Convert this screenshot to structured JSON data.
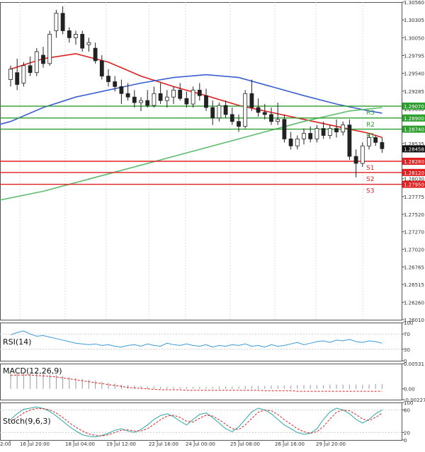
{
  "chart_data": [
    {
      "type": "candlestick",
      "panel": "price",
      "title": "",
      "ylim": [
        1.2601,
        1.3056
      ],
      "y_ticks": [
        "1.30560",
        "1.30305",
        "1.30050",
        "1.29795",
        "1.29540",
        "1.29285",
        "1.29030",
        "1.28535",
        "1.28030",
        "1.27775",
        "1.27520",
        "1.27270",
        "1.27020",
        "1.26765",
        "1.26515",
        "1.26260",
        "1.26010"
      ],
      "x_ticks": [
        "2:00",
        "16 Jul 20:00",
        "18 Jul 04:00",
        "19 Jul 12:00",
        "22 Jul 16:00",
        "24 Jul 00:00",
        "25 Jul 08:00",
        "26 Jul 16:00",
        "29 Jul 20:00"
      ],
      "current_price": {
        "label": "1.28458",
        "value": 1.28458
      },
      "levels": [
        {
          "name": "R3",
          "label": "1.29070",
          "value": 1.2907,
          "color": "#2e9e2e"
        },
        {
          "name": "R2",
          "label": "1.28900",
          "value": 1.289,
          "color": "#2e9e2e"
        },
        {
          "name": "R1",
          "label": "1.28740",
          "value": 1.2874,
          "color": "#2e9e2e"
        },
        {
          "name": "S1",
          "label": "1.28280",
          "value": 1.2828,
          "color": "#e02020"
        },
        {
          "name": "S2",
          "label": "1.28120",
          "value": 1.2812,
          "color": "#e02020"
        },
        {
          "name": "S3",
          "label": "1.27950",
          "value": 1.2795,
          "color": "#e02020"
        }
      ],
      "candles": [
        {
          "o": 1.2945,
          "h": 1.2965,
          "l": 1.2935,
          "c": 1.296
        },
        {
          "o": 1.2955,
          "h": 1.2975,
          "l": 1.293,
          "c": 1.2938
        },
        {
          "o": 1.294,
          "h": 1.297,
          "l": 1.2935,
          "c": 1.2965
        },
        {
          "o": 1.2965,
          "h": 1.2978,
          "l": 1.295,
          "c": 1.2955
        },
        {
          "o": 1.2955,
          "h": 1.299,
          "l": 1.295,
          "c": 1.2985
        },
        {
          "o": 1.298,
          "h": 1.2992,
          "l": 1.2962,
          "c": 1.2968
        },
        {
          "o": 1.2968,
          "h": 1.3015,
          "l": 1.2965,
          "c": 1.301
        },
        {
          "o": 1.3015,
          "h": 1.3045,
          "l": 1.3005,
          "c": 1.304
        },
        {
          "o": 1.304,
          "h": 1.305,
          "l": 1.301,
          "c": 1.3015
        },
        {
          "o": 1.3015,
          "h": 1.302,
          "l": 1.2998,
          "c": 1.3005
        },
        {
          "o": 1.3005,
          "h": 1.3015,
          "l": 1.2995,
          "c": 1.301
        },
        {
          "o": 1.301,
          "h": 1.3015,
          "l": 1.2985,
          "c": 1.299
        },
        {
          "o": 1.2995,
          "h": 1.3005,
          "l": 1.2985,
          "c": 1.2998
        },
        {
          "o": 1.299,
          "h": 1.2998,
          "l": 1.2968,
          "c": 1.2972
        },
        {
          "o": 1.2972,
          "h": 1.298,
          "l": 1.2945,
          "c": 1.295
        },
        {
          "o": 1.295,
          "h": 1.296,
          "l": 1.2935,
          "c": 1.2942
        },
        {
          "o": 1.2942,
          "h": 1.295,
          "l": 1.2928,
          "c": 1.2935
        },
        {
          "o": 1.2935,
          "h": 1.2945,
          "l": 1.291,
          "c": 1.2925
        },
        {
          "o": 1.2925,
          "h": 1.294,
          "l": 1.2915,
          "c": 1.292
        },
        {
          "o": 1.292,
          "h": 1.293,
          "l": 1.2905,
          "c": 1.2912
        },
        {
          "o": 1.2912,
          "h": 1.292,
          "l": 1.29,
          "c": 1.2915
        },
        {
          "o": 1.2915,
          "h": 1.293,
          "l": 1.2905,
          "c": 1.2908
        },
        {
          "o": 1.2908,
          "h": 1.2935,
          "l": 1.2905,
          "c": 1.2925
        },
        {
          "o": 1.2925,
          "h": 1.294,
          "l": 1.291,
          "c": 1.2915
        },
        {
          "o": 1.2915,
          "h": 1.293,
          "l": 1.2905,
          "c": 1.292
        },
        {
          "o": 1.292,
          "h": 1.2935,
          "l": 1.291,
          "c": 1.293
        },
        {
          "o": 1.293,
          "h": 1.294,
          "l": 1.2915,
          "c": 1.2918
        },
        {
          "o": 1.2918,
          "h": 1.2928,
          "l": 1.2905,
          "c": 1.291
        },
        {
          "o": 1.291,
          "h": 1.2935,
          "l": 1.2905,
          "c": 1.293
        },
        {
          "o": 1.293,
          "h": 1.294,
          "l": 1.2915,
          "c": 1.2922
        },
        {
          "o": 1.2922,
          "h": 1.2932,
          "l": 1.29,
          "c": 1.2905
        },
        {
          "o": 1.2905,
          "h": 1.2915,
          "l": 1.288,
          "c": 1.289
        },
        {
          "o": 1.289,
          "h": 1.2912,
          "l": 1.2885,
          "c": 1.2908
        },
        {
          "o": 1.2908,
          "h": 1.2915,
          "l": 1.289,
          "c": 1.2895
        },
        {
          "o": 1.2895,
          "h": 1.2905,
          "l": 1.288,
          "c": 1.2885
        },
        {
          "o": 1.2885,
          "h": 1.2895,
          "l": 1.287,
          "c": 1.2878
        },
        {
          "o": 1.2878,
          "h": 1.293,
          "l": 1.2875,
          "c": 1.2925
        },
        {
          "o": 1.2925,
          "h": 1.2945,
          "l": 1.29,
          "c": 1.2905
        },
        {
          "o": 1.2905,
          "h": 1.2918,
          "l": 1.2892,
          "c": 1.2898
        },
        {
          "o": 1.2898,
          "h": 1.291,
          "l": 1.2888,
          "c": 1.2895
        },
        {
          "o": 1.2895,
          "h": 1.2905,
          "l": 1.288,
          "c": 1.2885
        },
        {
          "o": 1.2885,
          "h": 1.2912,
          "l": 1.288,
          "c": 1.2888
        },
        {
          "o": 1.2888,
          "h": 1.2895,
          "l": 1.2855,
          "c": 1.286
        },
        {
          "o": 1.286,
          "h": 1.287,
          "l": 1.2845,
          "c": 1.285
        },
        {
          "o": 1.285,
          "h": 1.2865,
          "l": 1.2845,
          "c": 1.286
        },
        {
          "o": 1.286,
          "h": 1.2875,
          "l": 1.2852,
          "c": 1.2868
        },
        {
          "o": 1.2868,
          "h": 1.2878,
          "l": 1.2855,
          "c": 1.286
        },
        {
          "o": 1.286,
          "h": 1.288,
          "l": 1.2855,
          "c": 1.2875
        },
        {
          "o": 1.2875,
          "h": 1.2885,
          "l": 1.286,
          "c": 1.2865
        },
        {
          "o": 1.2865,
          "h": 1.288,
          "l": 1.286,
          "c": 1.2875
        },
        {
          "o": 1.2875,
          "h": 1.2888,
          "l": 1.2862,
          "c": 1.287
        },
        {
          "o": 1.287,
          "h": 1.2885,
          "l": 1.2865,
          "c": 1.288
        },
        {
          "o": 1.288,
          "h": 1.2888,
          "l": 1.283,
          "c": 1.2835
        },
        {
          "o": 1.2835,
          "h": 1.2845,
          "l": 1.2805,
          "c": 1.2825
        },
        {
          "o": 1.2825,
          "h": 1.2855,
          "l": 1.282,
          "c": 1.285
        },
        {
          "o": 1.285,
          "h": 1.2868,
          "l": 1.2845,
          "c": 1.2862
        },
        {
          "o": 1.2862,
          "h": 1.2865,
          "l": 1.285,
          "c": 1.2855
        },
        {
          "o": 1.2855,
          "h": 1.2862,
          "l": 1.284,
          "c": 1.2846
        }
      ],
      "moving_averages": [
        {
          "color": "#e02020",
          "values": [
            {
              "x": 0,
              "y": 1.296
            },
            {
              "x": 5,
              "y": 1.2975
            },
            {
              "x": 10,
              "y": 1.2982
            },
            {
              "x": 15,
              "y": 1.297
            },
            {
              "x": 20,
              "y": 1.295
            },
            {
              "x": 25,
              "y": 1.2935
            },
            {
              "x": 30,
              "y": 1.2922
            },
            {
              "x": 35,
              "y": 1.2908
            },
            {
              "x": 40,
              "y": 1.2898
            },
            {
              "x": 45,
              "y": 1.2888
            },
            {
              "x": 50,
              "y": 1.2878
            },
            {
              "x": 55,
              "y": 1.2868
            },
            {
              "x": 57,
              "y": 1.2862
            }
          ]
        },
        {
          "color": "#3a5fd0",
          "values": [
            {
              "x": -4,
              "y": 1.2875
            },
            {
              "x": 0,
              "y": 1.2885
            },
            {
              "x": 5,
              "y": 1.2905
            },
            {
              "x": 10,
              "y": 1.292
            },
            {
              "x": 15,
              "y": 1.293
            },
            {
              "x": 20,
              "y": 1.294
            },
            {
              "x": 25,
              "y": 1.2948
            },
            {
              "x": 30,
              "y": 1.2952
            },
            {
              "x": 35,
              "y": 1.2948
            },
            {
              "x": 40,
              "y": 1.2935
            },
            {
              "x": 45,
              "y": 1.2922
            },
            {
              "x": 50,
              "y": 1.291
            },
            {
              "x": 55,
              "y": 1.29
            },
            {
              "x": 57,
              "y": 1.2897
            }
          ]
        },
        {
          "color": "#5dbb6e",
          "values": [
            {
              "x": -4,
              "y": 1.2768
            },
            {
              "x": 5,
              "y": 1.2785
            },
            {
              "x": 15,
              "y": 1.281
            },
            {
              "x": 25,
              "y": 1.2835
            },
            {
              "x": 35,
              "y": 1.286
            },
            {
              "x": 45,
              "y": 1.2885
            },
            {
              "x": 52,
              "y": 1.29
            },
            {
              "x": 57,
              "y": 1.2905
            }
          ]
        }
      ]
    },
    {
      "type": "line",
      "panel": "rsi",
      "title": "RSI(14)",
      "ylim": [
        0,
        100
      ],
      "y_ticks": [
        "100",
        "70",
        "30",
        "0"
      ],
      "series": [
        {
          "color": "#3a9ad9",
          "values": [
            68,
            74,
            78,
            70,
            64,
            66,
            62,
            58,
            54,
            50,
            46,
            44,
            42,
            44,
            40,
            42,
            38,
            36,
            40,
            42,
            38,
            44,
            40,
            38,
            46,
            42,
            40,
            44,
            40,
            38,
            42,
            36,
            40,
            38,
            42,
            40,
            44,
            38,
            40,
            36,
            42,
            38,
            40,
            44,
            48,
            42,
            46,
            50,
            52,
            48,
            54,
            52,
            56,
            50,
            48,
            52,
            50,
            46
          ]
        }
      ]
    },
    {
      "type": "bar",
      "panel": "macd",
      "title": "MACD(12,26,9)",
      "ylim": [
        -0.002275,
        0.00531
      ],
      "y_ticks": [
        "0.00531",
        "0.00",
        "-0.002275"
      ],
      "series": [
        {
          "name": "",
          "color": "#999999",
          "values": [
            0.0032,
            0.0034,
            0.0035,
            0.0036,
            0.0035,
            0.0033,
            0.0031,
            0.0029,
            0.0027,
            0.0025,
            0.0023,
            0.0021,
            0.0019,
            0.0017,
            0.0015,
            0.0013,
            0.0011,
            0.0009,
            0.0008,
            0.0007,
            0.0006,
            0.0005,
            0.0005,
            0.0004,
            0.0004,
            0.0004,
            0.0004,
            0.0004,
            0.0004,
            0.0004,
            0.0004,
            0.0004,
            0.0005,
            0.0005,
            0.0005,
            0.0005,
            0.0006,
            0.0006,
            0.0006,
            0.0006,
            0.0007,
            0.0007,
            0.0007,
            0.0007,
            0.0008,
            0.0008,
            0.0008,
            0.0008,
            0.0008,
            0.0009,
            0.0009,
            0.0009,
            0.0009,
            0.0009,
            0.0009,
            0.0009,
            0.001,
            0.001
          ]
        },
        {
          "name": "",
          "color": "#e02020",
          "values": [
            0.0028,
            0.0029,
            0.0029,
            0.0029,
            0.0028,
            0.0027,
            0.0026,
            0.0025,
            0.0023,
            0.0021,
            0.0019,
            0.0017,
            0.0015,
            0.0013,
            0.0011,
            0.0009,
            0.0007,
            0.0005,
            0.0003,
            0.0002,
            0.0001,
            0.0,
            -0.0001,
            -0.0002,
            -0.0002,
            -0.0002,
            -0.0002,
            -0.0003,
            -0.0003,
            -0.0003,
            -0.0003,
            -0.0003,
            -0.0003,
            -0.0003,
            -0.0003,
            -0.0003,
            -0.0003,
            -0.0003,
            -0.0003,
            -0.0004,
            -0.0004,
            -0.0004,
            -0.0004,
            -0.0004,
            -0.0005,
            -0.0005,
            -0.0005,
            -0.0005,
            -0.0005,
            -0.0005,
            -0.0005,
            -0.0005,
            -0.0005,
            -0.0005,
            -0.0005,
            -0.0005,
            -0.0005,
            -0.0005
          ]
        }
      ]
    },
    {
      "type": "line",
      "panel": "stoch",
      "title": "Stoch(9,6,3)",
      "ylim": [
        0,
        100
      ],
      "y_ticks": [
        "100",
        "80",
        "20",
        "0"
      ],
      "series": [
        {
          "color": "#2aa8a8",
          "values": [
            55,
            70,
            82,
            85,
            88,
            84,
            76,
            64,
            50,
            36,
            24,
            14,
            10,
            8,
            12,
            18,
            26,
            30,
            24,
            20,
            28,
            40,
            55,
            65,
            70,
            62,
            50,
            40,
            55,
            68,
            72,
            60,
            45,
            30,
            22,
            35,
            55,
            75,
            85,
            80,
            70,
            55,
            40,
            30,
            20,
            15,
            18,
            30,
            55,
            75,
            85,
            80,
            70,
            55,
            45,
            55,
            70,
            80
          ]
        },
        {
          "color": "#e02020",
          "values": [
            50,
            60,
            72,
            80,
            84,
            84,
            80,
            72,
            60,
            46,
            34,
            24,
            16,
            12,
            11,
            14,
            20,
            26,
            27,
            24,
            24,
            30,
            42,
            54,
            64,
            66,
            60,
            50,
            48,
            58,
            66,
            64,
            54,
            42,
            30,
            28,
            40,
            58,
            74,
            80,
            78,
            68,
            54,
            42,
            30,
            22,
            18,
            22,
            36,
            56,
            74,
            80,
            78,
            68,
            56,
            52,
            60,
            72
          ]
        }
      ]
    }
  ]
}
